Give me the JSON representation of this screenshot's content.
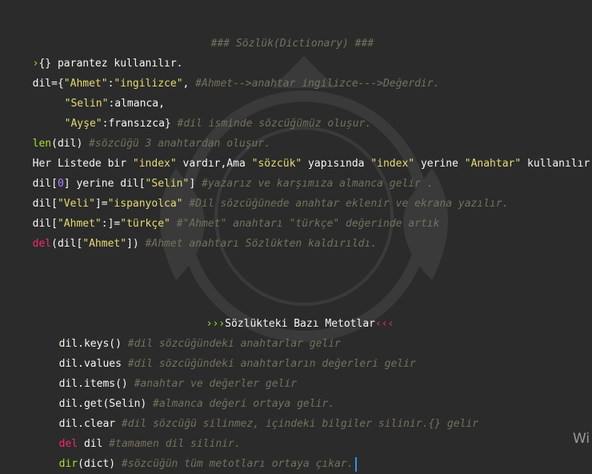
{
  "title": "### Sözlük(Dictionary) ###",
  "lines": {
    "l1": {
      "arrow": "›",
      "text": "{} parantez kullanılır."
    },
    "l2": {
      "a": "dil={",
      "b": "\"Ahmet\"",
      "c": ":",
      "d": "\"ingilizce\"",
      "e": ", ",
      "f": "#Ahmet-->anahtar ingilizce--->Değerdir."
    },
    "l3": {
      "a": "\"Selin\"",
      "b": ":almanca,"
    },
    "l4": {
      "a": "\"Ayşe\"",
      "b": ":fransızca}",
      "c": " #dil isminde sözcüğümüz oluşur."
    },
    "l5": {
      "a": "len",
      "b": "(dil)",
      "c": " #sözcüğü 3 anahtardan oluşur."
    },
    "l6": {
      "a": "Her Listede bir ",
      "b": "\"index\"",
      "c": " vardır,Ama ",
      "d": "\"sözcük\"",
      "e": " yapısında ",
      "f": "\"index\"",
      "g": " yerine ",
      "h": "\"Anahtar\"",
      "i": " kullanılır"
    },
    "l7": {
      "a": "dil[",
      "b": "0",
      "c": "] yerine dil[",
      "d": "\"Selin\"",
      "e": "]",
      "f": " #yazarız ve karşımıza almanca gelir ."
    },
    "l8": {
      "a": "dil[",
      "b": "\"Veli\"",
      "c": "]=",
      "d": "\"ispanyolca\"",
      "e": " #Dil sözcüğünede anahtar eklenir ve ekrana yazılır."
    },
    "l9": {
      "a": "dil[",
      "b": "\"Ahmet\"",
      "c": ":]=",
      "d": "\"türkçe\"",
      "e": " #\"Ahmet\" anahtarı \"türkçe\" değerinde artık"
    },
    "l10": {
      "a": "del",
      "b": "(dil[",
      "c": "\"Ahmet\"",
      "d": "])",
      "e": " #Ahmet anahtarı Sözlükten kaldırıldı."
    }
  },
  "section": {
    "left": "›››",
    "title": "Sözlükteki Bazı Metotlar",
    "right": "‹‹‹"
  },
  "methods": {
    "m1": {
      "a": "dil.keys()",
      "b": " #dil sözcüğündeki anahtarlar gelir"
    },
    "m2": {
      "a": "dil.values",
      "b": " #dil sözcüğündeki anahtarların değerleri gelir"
    },
    "m3": {
      "a": "dil.items()",
      "b": " #anahtar ve değerler gelir"
    },
    "m4": {
      "a": "dil.get(Selin)",
      "b": " #almanca değeri ortaya gelir."
    },
    "m5": {
      "a": "dil.clear",
      "b": " #dil sözcüğü silinmez, içindeki bilgiler silinir.{} gelir"
    },
    "m6": {
      "a": "del",
      "b": " dil",
      "c": " #tamamen dil silinir."
    },
    "m7": {
      "a": "dir",
      "b": "(dict)",
      "c": " #sözcüğün tüm metotları ortaya çıkar."
    }
  },
  "watermark_text": "Wi",
  "colors": {
    "background": "#2b2b2b",
    "string": "#e6db74",
    "comment": "#75715e",
    "keyword": "#f92672",
    "function": "#a6e22e",
    "number": "#ae81ff"
  }
}
